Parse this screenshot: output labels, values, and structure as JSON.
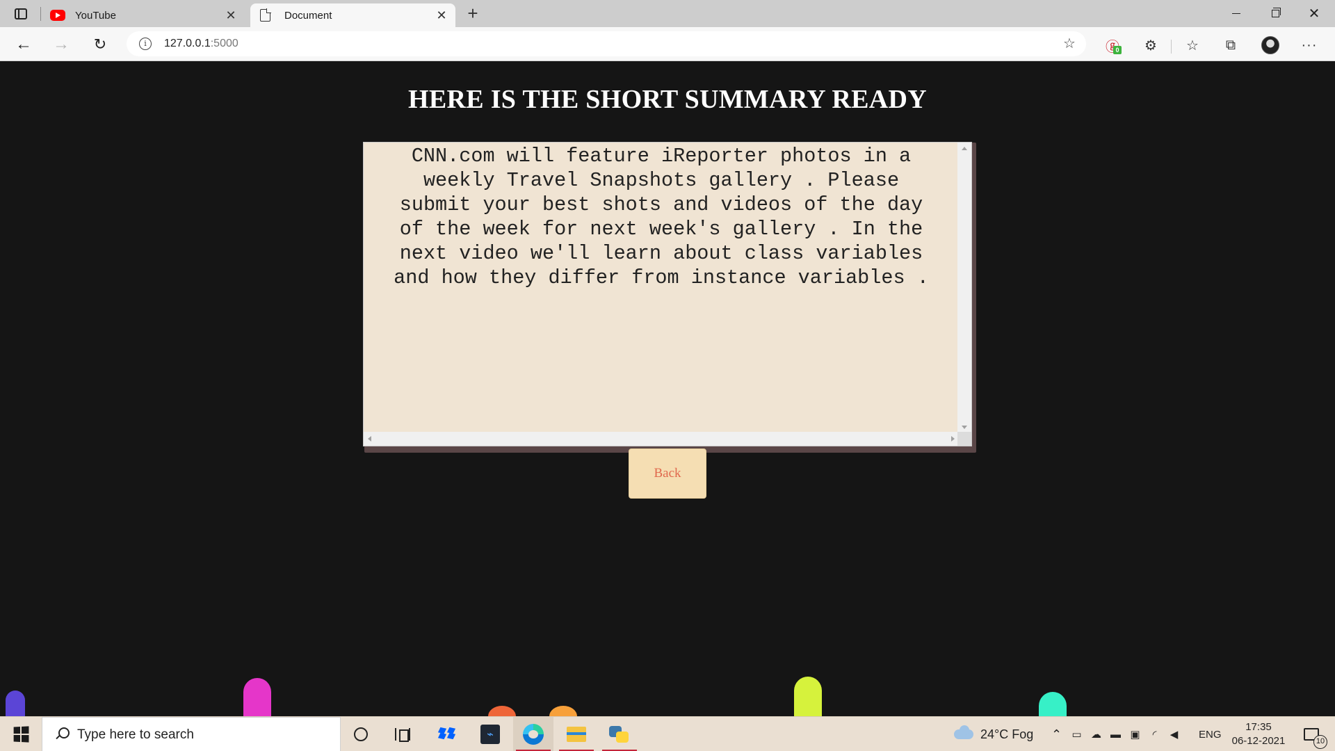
{
  "browser": {
    "tabs": [
      {
        "title": "YouTube",
        "icon": "youtube-icon",
        "active": false
      },
      {
        "title": "Document",
        "icon": "document-icon",
        "active": true
      }
    ],
    "new_tab_glyph": "+",
    "close_glyph": "✕",
    "url_host": "127.0.0.1",
    "url_port": ":5000",
    "tracker_badge": "0"
  },
  "page": {
    "title": "HERE IS THE SHORT SUMMARY READY",
    "summary": "CNN.com will feature iReporter photos in a\nweekly Travel Snapshots gallery . Please\nsubmit your best shots and videos of the day\nof the week for next week's gallery . In the\nnext video we'll learn about class variables\nand how they differ from instance variables .",
    "back_label": "Back",
    "colors": {
      "background": "#151515",
      "summary_bg": "#f0e4d3",
      "button_bg": "#f5deb3",
      "button_text": "#e0694e"
    }
  },
  "taskbar": {
    "search_placeholder": "Type here to search",
    "weather": "24°C  Fog",
    "language": "ENG",
    "time": "17:35",
    "date": "06-12-2021",
    "notification_count": "10"
  }
}
